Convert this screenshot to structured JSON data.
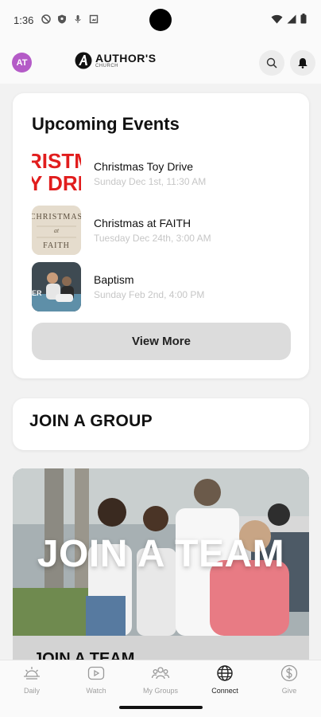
{
  "status_bar": {
    "time": "1:36"
  },
  "header": {
    "avatar_initials": "AT",
    "logo_main": "AUTHOR'S",
    "logo_sub": "CHURCH"
  },
  "events": {
    "title": "Upcoming Events",
    "items": [
      {
        "name": "Christmas Toy Drive",
        "date": "Sunday Dec 1st, 11:30 AM",
        "thumb_text": [
          "RISTM",
          "Y DRI"
        ]
      },
      {
        "name": "Christmas at FAITH",
        "date": "Tuesday Dec 24th, 3:00 AM",
        "thumb_text": [
          "CHRISTMAS",
          "at",
          "FAITH"
        ]
      },
      {
        "name": "Baptism",
        "date": "Sunday Feb 2nd, 4:00 PM",
        "thumb_text": [
          "ER"
        ]
      }
    ],
    "view_more": "View More"
  },
  "group": {
    "title": "JOIN A GROUP"
  },
  "team": {
    "banner_text": "JOIN A TEAM",
    "caption": "JOIN A TEAM"
  },
  "nav": {
    "items": [
      {
        "label": "Daily",
        "icon": "sunrise-icon"
      },
      {
        "label": "Watch",
        "icon": "play-icon"
      },
      {
        "label": "My Groups",
        "icon": "groups-icon"
      },
      {
        "label": "Connect",
        "icon": "globe-icon"
      },
      {
        "label": "Give",
        "icon": "dollar-icon"
      }
    ],
    "active": "Connect"
  },
  "colors": {
    "avatar": "#b45bc7",
    "toy_drive_red": "#e11d1d"
  }
}
